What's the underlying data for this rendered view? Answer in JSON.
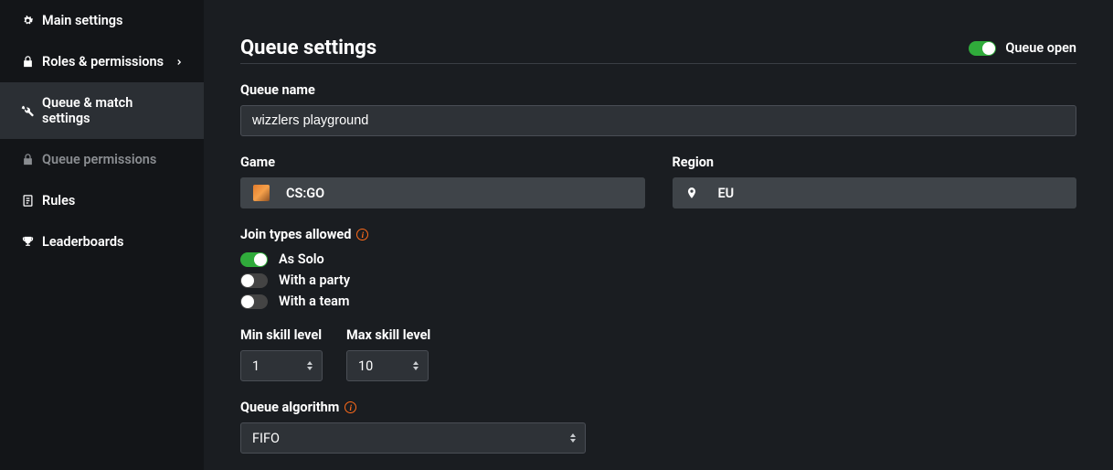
{
  "sidebar": {
    "items": [
      {
        "label": "Main settings",
        "icon": "gear"
      },
      {
        "label": "Roles & permissions",
        "icon": "lock",
        "expandable": true
      },
      {
        "label": "Queue & match settings",
        "icon": "tools",
        "active": true
      },
      {
        "label": "Queue permissions",
        "icon": "lock",
        "disabled": true
      },
      {
        "label": "Rules",
        "icon": "document"
      },
      {
        "label": "Leaderboards",
        "icon": "trophy"
      }
    ]
  },
  "header": {
    "title": "Queue settings",
    "queue_open_label": "Queue open",
    "queue_open": true
  },
  "form": {
    "queue_name": {
      "label": "Queue name",
      "value": "wizzlers playground"
    },
    "game": {
      "label": "Game",
      "value": "CS:GO"
    },
    "region": {
      "label": "Region",
      "value": "EU"
    },
    "join_types": {
      "label": "Join types allowed",
      "options": [
        {
          "label": "As Solo",
          "on": true
        },
        {
          "label": "With a party",
          "on": false
        },
        {
          "label": "With a team",
          "on": false
        }
      ]
    },
    "min_skill": {
      "label": "Min skill level",
      "value": "1"
    },
    "max_skill": {
      "label": "Max skill level",
      "value": "10"
    },
    "algorithm": {
      "label": "Queue algorithm",
      "value": "FIFO"
    }
  }
}
